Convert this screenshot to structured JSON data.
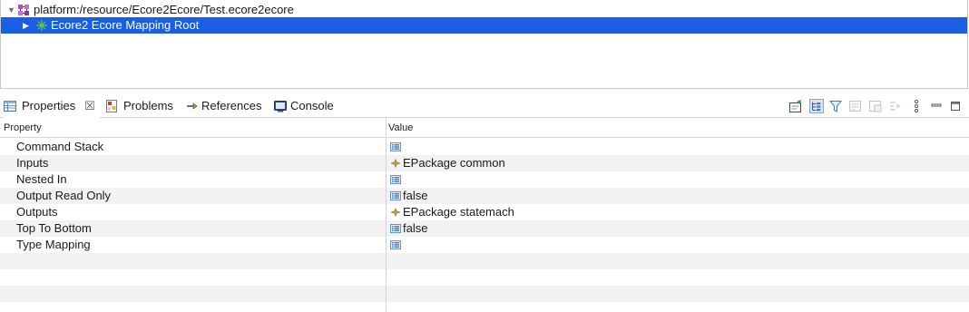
{
  "tree": {
    "root": {
      "label": "platform:/resource/Ecore2Ecore/Test.ecore2ecore",
      "icon": "resource-set-icon",
      "expanded": true
    },
    "children": [
      {
        "label": "Ecore2 Ecore Mapping Root",
        "icon": "mapping-root-icon",
        "selected": true,
        "expanded": false
      }
    ],
    "selection_color": "#1a5ee6"
  },
  "tabs": [
    {
      "label": "Properties",
      "icon": "properties-icon",
      "active": true,
      "closable": true
    },
    {
      "label": "Problems",
      "icon": "problems-icon",
      "active": false
    },
    {
      "label": "References",
      "icon": "references-icon",
      "active": false
    },
    {
      "label": "Console",
      "icon": "console-icon",
      "active": false
    }
  ],
  "toolbar": [
    "pin-to-selection-icon",
    "show-categories-icon",
    "filter-icon",
    "show-advanced-icon",
    "restore-default-icon",
    "link-icon",
    "view-menu-icon",
    "minimize-icon",
    "maximize-icon"
  ],
  "properties": {
    "columns": {
      "property": "Property",
      "value": "Value"
    },
    "rows": [
      {
        "name": "Command Stack",
        "value": "",
        "value_icon": "value-list-icon"
      },
      {
        "name": "Inputs",
        "value": "EPackage common",
        "value_icon": "epackage-icon"
      },
      {
        "name": "Nested In",
        "value": "",
        "value_icon": "value-list-icon"
      },
      {
        "name": "Output Read Only",
        "value": "false",
        "value_icon": "value-list-icon"
      },
      {
        "name": "Outputs",
        "value": "EPackage statemach",
        "value_icon": "epackage-icon"
      },
      {
        "name": "Top To Bottom",
        "value": "false",
        "value_icon": "value-list-icon"
      },
      {
        "name": "Type Mapping",
        "value": "",
        "value_icon": "value-list-icon"
      }
    ]
  }
}
